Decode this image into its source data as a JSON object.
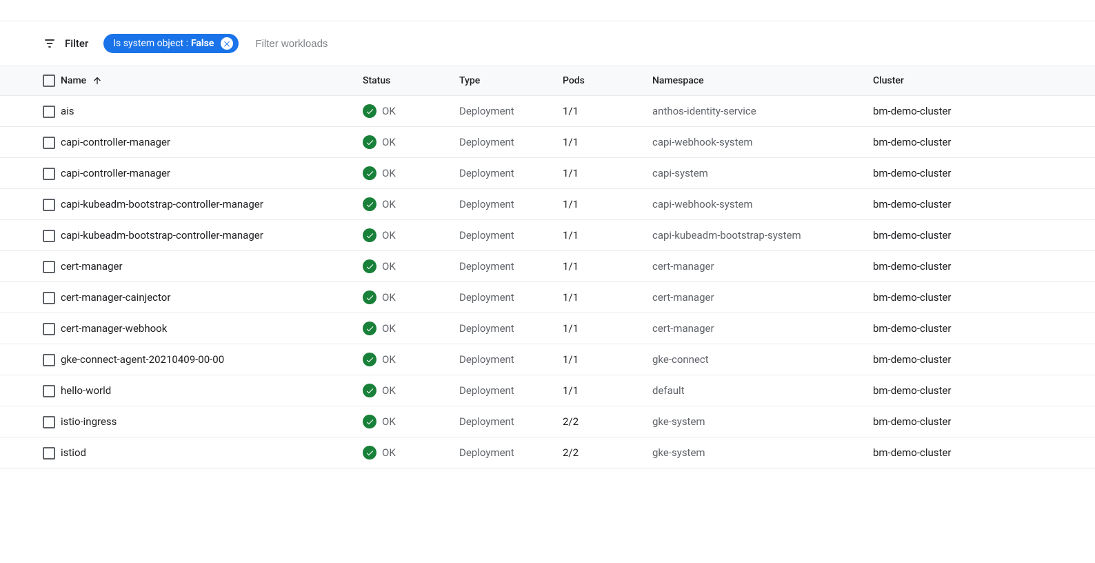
{
  "filter": {
    "label": "Filter",
    "chip_key": "Is system object : ",
    "chip_value": "False",
    "placeholder": "Filter workloads"
  },
  "columns": {
    "name": "Name",
    "status": "Status",
    "type": "Type",
    "pods": "Pods",
    "namespace": "Namespace",
    "cluster": "Cluster"
  },
  "rows": [
    {
      "name": "ais",
      "status": "OK",
      "type": "Deployment",
      "pods": "1/1",
      "namespace": "anthos-identity-service",
      "cluster": "bm-demo-cluster"
    },
    {
      "name": "capi-controller-manager",
      "status": "OK",
      "type": "Deployment",
      "pods": "1/1",
      "namespace": "capi-webhook-system",
      "cluster": "bm-demo-cluster"
    },
    {
      "name": "capi-controller-manager",
      "status": "OK",
      "type": "Deployment",
      "pods": "1/1",
      "namespace": "capi-system",
      "cluster": "bm-demo-cluster"
    },
    {
      "name": "capi-kubeadm-bootstrap-controller-manager",
      "status": "OK",
      "type": "Deployment",
      "pods": "1/1",
      "namespace": "capi-webhook-system",
      "cluster": "bm-demo-cluster"
    },
    {
      "name": "capi-kubeadm-bootstrap-controller-manager",
      "status": "OK",
      "type": "Deployment",
      "pods": "1/1",
      "namespace": "capi-kubeadm-bootstrap-system",
      "cluster": "bm-demo-cluster"
    },
    {
      "name": "cert-manager",
      "status": "OK",
      "type": "Deployment",
      "pods": "1/1",
      "namespace": "cert-manager",
      "cluster": "bm-demo-cluster"
    },
    {
      "name": "cert-manager-cainjector",
      "status": "OK",
      "type": "Deployment",
      "pods": "1/1",
      "namespace": "cert-manager",
      "cluster": "bm-demo-cluster"
    },
    {
      "name": "cert-manager-webhook",
      "status": "OK",
      "type": "Deployment",
      "pods": "1/1",
      "namespace": "cert-manager",
      "cluster": "bm-demo-cluster"
    },
    {
      "name": "gke-connect-agent-20210409-00-00",
      "status": "OK",
      "type": "Deployment",
      "pods": "1/1",
      "namespace": "gke-connect",
      "cluster": "bm-demo-cluster"
    },
    {
      "name": "hello-world",
      "status": "OK",
      "type": "Deployment",
      "pods": "1/1",
      "namespace": "default",
      "cluster": "bm-demo-cluster"
    },
    {
      "name": "istio-ingress",
      "status": "OK",
      "type": "Deployment",
      "pods": "2/2",
      "namespace": "gke-system",
      "cluster": "bm-demo-cluster"
    },
    {
      "name": "istiod",
      "status": "OK",
      "type": "Deployment",
      "pods": "2/2",
      "namespace": "gke-system",
      "cluster": "bm-demo-cluster"
    }
  ]
}
